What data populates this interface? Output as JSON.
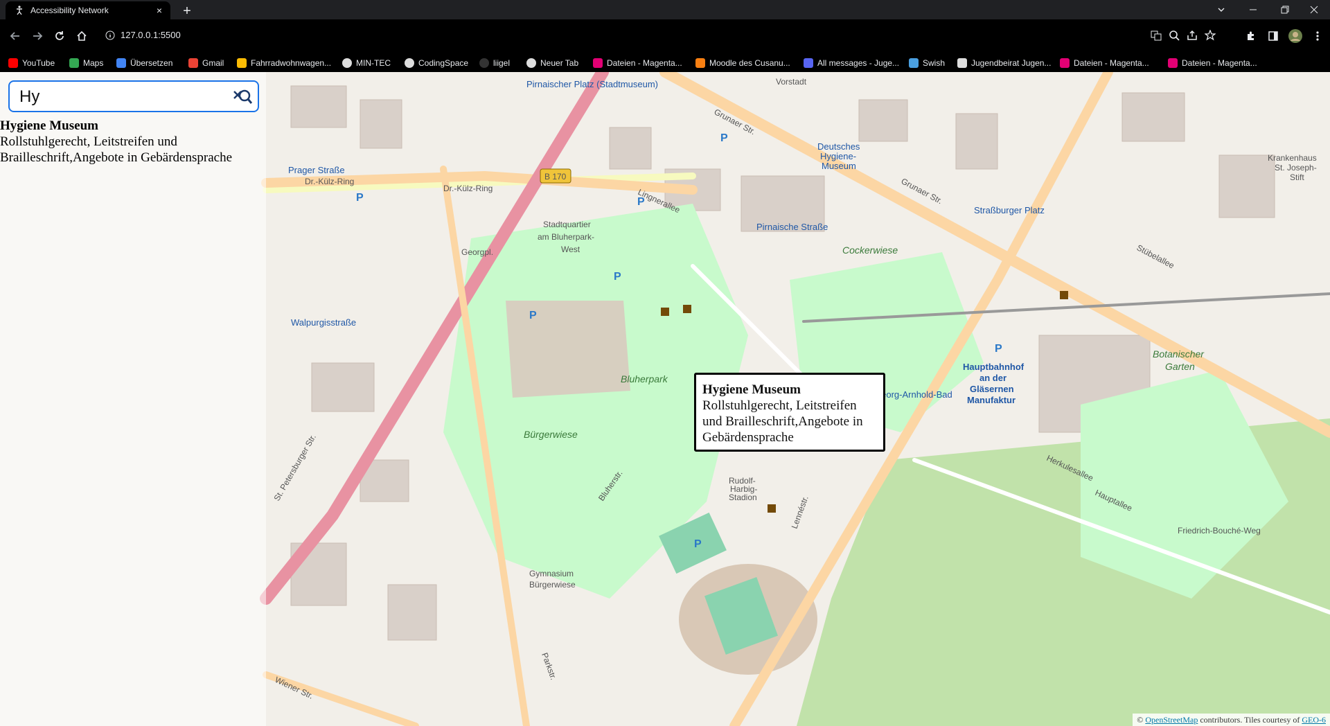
{
  "browser": {
    "tab": {
      "title": "Accessibility Network",
      "close": "×"
    },
    "new_tab": "+",
    "address": "127.0.0.1:5500",
    "bookmarks": [
      {
        "label": "YouTube",
        "color": "#ff0000"
      },
      {
        "label": "Maps",
        "color": "#34a853"
      },
      {
        "label": "Übersetzen",
        "color": "#4285f4"
      },
      {
        "label": "Gmail",
        "color": "#ea4335"
      },
      {
        "label": "Fahrradwohnwagen...",
        "color": "#fbbc04"
      },
      {
        "label": "MIN-TEC",
        "color": "#dddddd"
      },
      {
        "label": "CodingSpace",
        "color": "#dddddd"
      },
      {
        "label": "liigel",
        "color": "#222222"
      },
      {
        "label": "Neuer Tab",
        "color": "#dddddd"
      },
      {
        "label": "Dateien - Magenta...",
        "color": "#e20074"
      },
      {
        "label": "Moodle des Cusanu...",
        "color": "#f98012"
      },
      {
        "label": "All messages - Juge...",
        "color": "#5865f2"
      },
      {
        "label": "Swish",
        "color": "#4a9fe0"
      },
      {
        "label": "Jugendbeirat Jugen...",
        "color": "#dddddd"
      },
      {
        "label": "Dateien - Magenta...",
        "color": "#e20074"
      },
      {
        "label": "Dateien - Magenta...",
        "color": "#e20074"
      }
    ]
  },
  "search": {
    "value": "Hy",
    "placeholder": ""
  },
  "results": [
    {
      "title": "Hygiene Museum",
      "description": "Rollstuhlgerecht, Leitstreifen und Brailleschrift,Angebote in Gebärdensprache"
    }
  ],
  "popup": {
    "title": "Hygiene Museum",
    "description": "Rollstuhlgerecht, Leitstreifen und Brailleschrift,Angebote in Gebärdensprache"
  },
  "attribution": {
    "prefix": "© ",
    "link": "OpenStreetMap",
    "suffix": " contributors. Tiles courtesy of ",
    "link2": "GEO-6"
  },
  "map_labels": {
    "vorstadt": "Vorstadt",
    "grunaer": "Grunaer Str.",
    "grunaer2": "Grunaer Str.",
    "pirnaischer": "Pirnaischer Platz (Stadtmuseum)",
    "dr_kulz": "Dr.-Külz-Ring",
    "dr_kulz2": "Dr.-Külz-Ring",
    "georgpl": "Georgpl.",
    "b170": "B 170",
    "stadtquartier": "Stadtquartier",
    "am_bluherpark": "am Bluherpark-",
    "west": "West",
    "deutsches": "Deutsches",
    "hygiene": "Hygiene-",
    "museum": "Museum",
    "pirnaische_strasse": "Pirnaische Straße",
    "cockerwiese": "Cockerwiese",
    "bluherpark": "Bluherpark",
    "burgerwiese": "Bürgerwiese",
    "hbf": "Hauptbahnhof",
    "an_der": "an der",
    "glasernen": "Gläsernen",
    "manufaktur": "Manufaktur",
    "botanischer": "Botanischer",
    "garten": "Garten",
    "stubelallee": "Stübelallee",
    "walpurgisstrasse": "Walpurgisstraße",
    "st_petersburger": "St. Petersburger Str.",
    "rudolf": "Rudolf-",
    "harbig": "Harbig-",
    "stadion": "Stadion",
    "gymnasium": "Gymnasium",
    "burgerwiese2": "Bürgerwiese",
    "lennestr": "Lennéstr.",
    "hauptallee": "Hauptallee",
    "krankenhaus": "Krankenhaus",
    "st_joseph": "St. Joseph-",
    "stift": "Stift",
    "prager": "Prager Straße",
    "georg_arnhold": "Georg-Arnhold-Bad",
    "herkulesallee": "Herkulesallee",
    "friedrich": "Friedrich-Bouché-Weg",
    "wiener": "Wiener Str.",
    "parkstr": "Parkstr.",
    "bluherstr": "Bluherstr.",
    "lingnerallee": "Lingnerallee",
    "strassburger": "Straßburger Platz"
  }
}
